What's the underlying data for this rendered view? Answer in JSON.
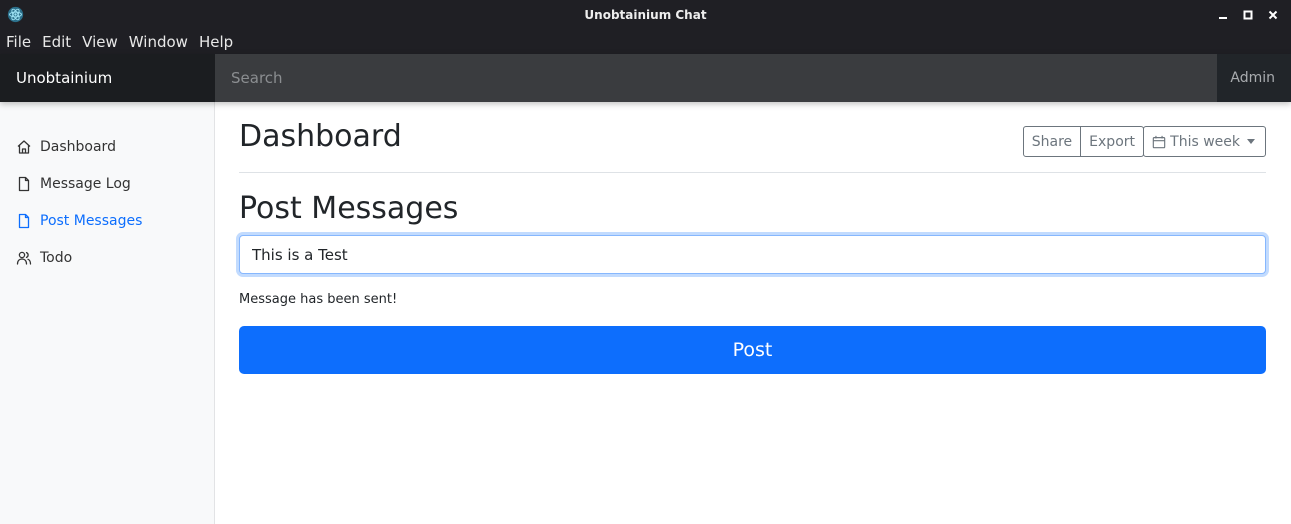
{
  "window": {
    "title": "Unobtainium Chat",
    "icon": "electron-atom-icon",
    "controls": [
      "minimize",
      "maximize",
      "close"
    ]
  },
  "menu": [
    "File",
    "Edit",
    "View",
    "Window",
    "Help"
  ],
  "navbar": {
    "brand": "Unobtainium",
    "search_placeholder": "Search",
    "user_link": "Admin"
  },
  "sidebar": {
    "items": [
      {
        "label": "Dashboard",
        "icon": "home-icon",
        "active": false
      },
      {
        "label": "Message Log",
        "icon": "file-icon",
        "active": false
      },
      {
        "label": "Post Messages",
        "icon": "file-icon",
        "active": true
      },
      {
        "label": "Todo",
        "icon": "users-icon",
        "active": false
      }
    ]
  },
  "header": {
    "title": "Dashboard",
    "share_label": "Share",
    "export_label": "Export",
    "period_label": "This week"
  },
  "main": {
    "section_title": "Post Messages",
    "message_value": "This is a Test",
    "status": "Message has been sent!",
    "post_label": "Post"
  },
  "colors": {
    "accent": "#0d6efd",
    "navbar": "#212529",
    "titlebar": "#1f1f24"
  }
}
